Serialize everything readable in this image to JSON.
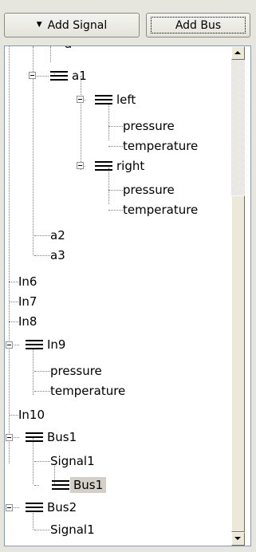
{
  "toolbar": {
    "add_signal_label": "Add Signal",
    "add_signal_arrow": "▼",
    "add_bus_label": "Add Bus"
  },
  "tree": {
    "partial_top_label": "a",
    "nodes": {
      "a1": "a1",
      "left": "left",
      "left_pressure": "pressure",
      "left_temperature": "temperature",
      "right": "right",
      "right_pressure": "pressure",
      "right_temperature": "temperature",
      "a2": "a2",
      "a3": "a3",
      "in6": "In6",
      "in7": "In7",
      "in8": "In8",
      "in9": "In9",
      "in9_pressure": "pressure",
      "in9_temperature": "temperature",
      "in10": "In10",
      "bus1": "Bus1",
      "bus1_signal1": "Signal1",
      "bus1_bus1": "Bus1",
      "bus2": "Bus2",
      "bus2_signal1": "Signal1"
    },
    "selected": "bus1_bus1"
  },
  "icons": {
    "bus": "bus-icon",
    "expander": "collapse-icon"
  },
  "colors": {
    "selection": "#d4d0c8",
    "panel_border": "#7f9db9"
  }
}
